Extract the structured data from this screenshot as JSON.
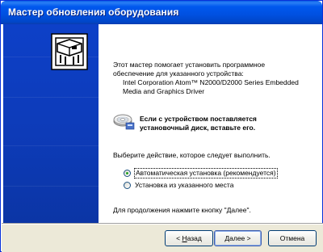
{
  "window": {
    "title": "Мастер обновления оборудования"
  },
  "intro": {
    "line1": "Этот мастер помогает установить программное",
    "line2": "обеспечение для указанного устройства:",
    "device_line1": "Intel Corporation Atom™ N2000/D2000 Series Embedded",
    "device_line2": "Media and Graphics Driver"
  },
  "disc_hint": {
    "line1": "Если с устройством поставляется",
    "line2": "установочный диск, вставьте его.",
    "icon": "cd-icon"
  },
  "choose_prompt": "Выберите действие, которое следует выполнить.",
  "options": [
    {
      "label": "Автоматическая установка (рекомендуется)",
      "checked": true
    },
    {
      "label": "Установка из указанного места",
      "checked": false
    }
  ],
  "continue_hint": "Для продолжения нажмите кнопку \"Далее\".",
  "buttons": {
    "back_prefix": "< ",
    "back_hotkey": "Н",
    "back_rest": "азад",
    "next_hotkey": "Д",
    "next_rest": "алее >",
    "cancel": "Отмена"
  },
  "colors": {
    "title_bar": "#0058ee",
    "left_panel": "#0d3bb8",
    "button_face": "#ece9d8"
  }
}
